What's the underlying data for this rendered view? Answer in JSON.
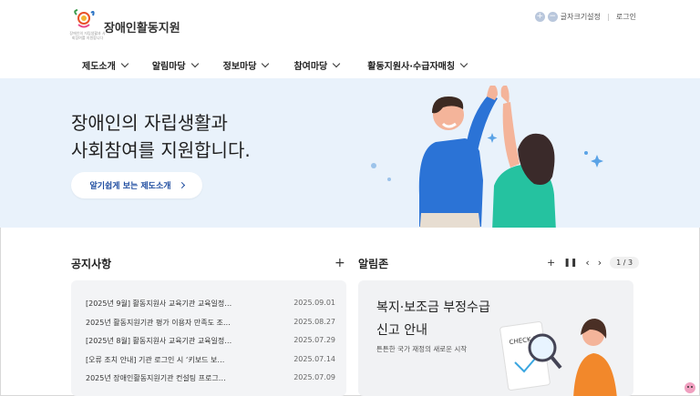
{
  "header": {
    "logo_text": "장애인활동지원",
    "logo_sub": "장애인의 자립생활과 사회참여를 지원합니다",
    "font_size_label": "글자크기설정",
    "login_label": "로그인"
  },
  "gnb": [
    {
      "label": "제도소개"
    },
    {
      "label": "알림마당"
    },
    {
      "label": "정보마당"
    },
    {
      "label": "참여마당"
    },
    {
      "label": "활동지원사·수급자매칭"
    }
  ],
  "hero": {
    "title_line1": "장애인의 자립생활과",
    "title_line2": "사회참여를 지원합니다.",
    "button_label": "알기쉽게 보는 제도소개"
  },
  "notice": {
    "title": "공지사항",
    "more": "+",
    "items": [
      {
        "title": "[2025년 9월] 활동지원사 교육기관 교육일정…",
        "date": "2025.09.01"
      },
      {
        "title": "2025년 활동지원기관 평가 이용자 만족도 조…",
        "date": "2025.08.27"
      },
      {
        "title": "[2025년 8월] 활동지원사 교육기관 교육일정…",
        "date": "2025.07.29"
      },
      {
        "title": "[오류 조치 안내] 기관 로그인 시 ‘키보드 보…",
        "date": "2025.07.14"
      },
      {
        "title": "2025년 장애인활동지원기관 컨설팅 프로그…",
        "date": "2025.07.09"
      }
    ]
  },
  "alarm": {
    "title": "알림존",
    "pager": "1 / 3",
    "banner_title_1": "복지·보조금 부정수급",
    "banner_title_2": "신고 안내",
    "banner_sub": "튼튼한 국가 재정의 새로운 시작",
    "checklist_text": "CHECK LIST"
  },
  "colors": {
    "hero_bg": "#e9f2fb",
    "accent": "#1f4da0",
    "card_bg": "#f3f4f6"
  }
}
